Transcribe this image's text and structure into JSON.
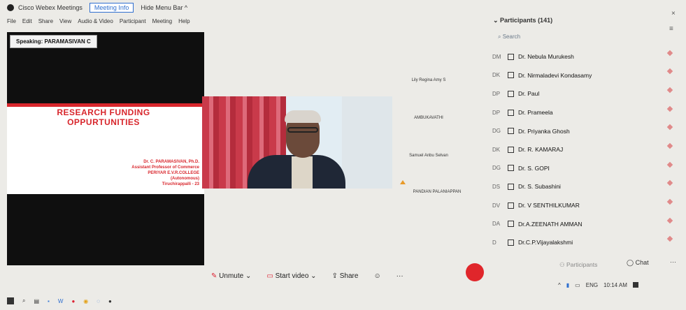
{
  "window": {
    "app_title": "Cisco Webex Meetings",
    "tab_label": "Meeting Info",
    "hide_menu": "Hide Menu Bar ^"
  },
  "menu": [
    "File",
    "Edit",
    "Share",
    "View",
    "Audio & Video",
    "Participant",
    "Meeting",
    "Help"
  ],
  "share": {
    "speaking_label": "Speaking: PARAMASIVAN C",
    "slide_title_1": "RESEARCH FUNDING",
    "slide_title_2": "OPPURTUNITIES",
    "presenter_lines": [
      "Dr. C. PARAMASIVAN, Ph.D.",
      "Assistant Professor of Commerce",
      "PERIYAR E.V.R.COLLEGE",
      "(Autonomous)",
      "Tiruchirappalli - 23"
    ]
  },
  "tiles": [
    "Lily Regina Amy S",
    "AMBUKAVATHI",
    "Samuel Anbu Selvan",
    "PANDIAN PALANIAPPAN"
  ],
  "participants": {
    "header": "Participants (141)",
    "search_placeholder": "Search",
    "items": [
      {
        "initials": "DM",
        "name": "Dr. Nebula Murukesh"
      },
      {
        "initials": "DK",
        "name": "Dr. Nirmaladevi Kondasamy"
      },
      {
        "initials": "DP",
        "name": "Dr. Paul"
      },
      {
        "initials": "DP",
        "name": "Dr. Prameela"
      },
      {
        "initials": "DG",
        "name": "Dr. Priyanka Ghosh"
      },
      {
        "initials": "DK",
        "name": "Dr. R. KAMARAJ"
      },
      {
        "initials": "DG",
        "name": "Dr. S. GOPI"
      },
      {
        "initials": "DS",
        "name": "Dr. S. Subashini"
      },
      {
        "initials": "DV",
        "name": "Dr. V SENTHILKUMAR"
      },
      {
        "initials": "DA",
        "name": "Dr.A.ZEENATH AMMAN"
      },
      {
        "initials": "D",
        "name": "Dr.C.P.Vijayalakshmi"
      }
    ]
  },
  "toolbar": {
    "unmute": "Unmute",
    "start_video": "Start video",
    "share": "Share",
    "more": "···",
    "participants": "Participants",
    "chat": "Chat",
    "overflow": "···"
  },
  "taskbar": {
    "language": "ENG",
    "time": "10:14 AM"
  },
  "colors": {
    "end_button": "#e0262b",
    "slide_accent": "#d8262c",
    "link_blue": "#2f6fcf"
  }
}
